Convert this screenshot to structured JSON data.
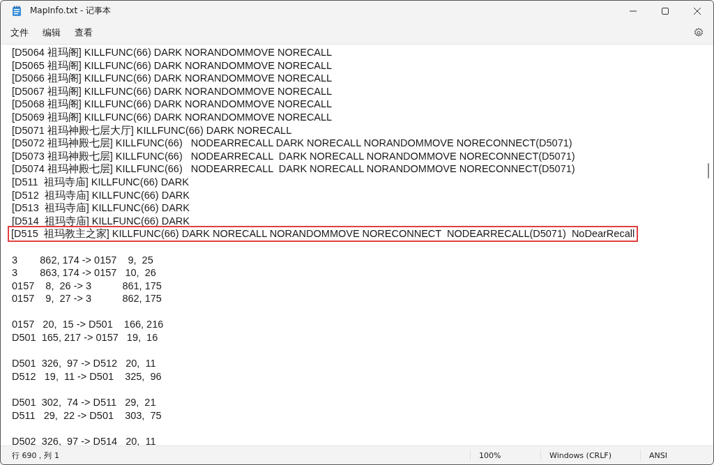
{
  "window": {
    "title": "MapInfo.txt - 记事本"
  },
  "menu": [
    "文件",
    "编辑",
    "查看"
  ],
  "blocks": [
    {
      "lines": [
        {
          "text": "[D5064 祖玛阁] KILLFUNC(66) DARK NORANDOMMOVE NORECALL",
          "highlighted": false
        },
        {
          "text": "[D5065 祖玛阁] KILLFUNC(66) DARK NORANDOMMOVE NORECALL",
          "highlighted": false
        },
        {
          "text": "[D5066 祖玛阁] KILLFUNC(66) DARK NORANDOMMOVE NORECALL",
          "highlighted": false
        },
        {
          "text": "[D5067 祖玛阁] KILLFUNC(66) DARK NORANDOMMOVE NORECALL",
          "highlighted": false
        },
        {
          "text": "[D5068 祖玛阁] KILLFUNC(66) DARK NORANDOMMOVE NORECALL",
          "highlighted": false
        },
        {
          "text": "[D5069 祖玛阁] KILLFUNC(66) DARK NORANDOMMOVE NORECALL",
          "highlighted": false
        },
        {
          "text": "[D5071 祖玛神殿七层大厅] KILLFUNC(66) DARK NORECALL",
          "highlighted": false
        },
        {
          "text": "[D5072 祖玛神殿七层] KILLFUNC(66)   NODEARRECALL DARK NORECALL NORANDOMMOVE NORECONNECT(D5071)",
          "highlighted": false
        },
        {
          "text": "[D5073 祖玛神殿七层] KILLFUNC(66)   NODEARRECALL  DARK NORECALL NORANDOMMOVE NORECONNECT(D5071)",
          "highlighted": false
        },
        {
          "text": "[D5074 祖玛神殿七层] KILLFUNC(66)   NODEARRECALL  DARK NORECALL NORANDOMMOVE NORECONNECT(D5071)",
          "highlighted": false
        },
        {
          "text": "[D511  祖玛寺庙] KILLFUNC(66) DARK",
          "highlighted": false
        },
        {
          "text": "[D512  祖玛寺庙] KILLFUNC(66) DARK",
          "highlighted": false
        },
        {
          "text": "[D513  祖玛寺庙] KILLFUNC(66) DARK",
          "highlighted": false
        },
        {
          "text": "[D514  祖玛寺庙] KILLFUNC(66) DARK",
          "highlighted": false
        },
        {
          "text": "[D515  祖玛教主之家] KILLFUNC(66) DARK NORECALL NORANDOMMOVE NORECONNECT  NODEARRECALL(D5071)  NoDearRecall",
          "highlighted": true
        }
      ]
    },
    {
      "lines": [
        {
          "text": "3        862, 174 -> 0157    9,  25",
          "highlighted": false
        },
        {
          "text": "3        863, 174 -> 0157   10,  26",
          "highlighted": false
        },
        {
          "text": "0157    8,  26 -> 3           861, 175",
          "highlighted": false
        },
        {
          "text": "0157    9,  27 -> 3           862, 175",
          "highlighted": false
        }
      ]
    },
    {
      "lines": [
        {
          "text": "0157   20,  15 -> D501    166, 216",
          "highlighted": false
        },
        {
          "text": "D501  165, 217 -> 0157   19,  16",
          "highlighted": false
        }
      ]
    },
    {
      "lines": [
        {
          "text": "D501  326,  97 -> D512   20,  11",
          "highlighted": false
        },
        {
          "text": "D512   19,  11 -> D501    325,  96",
          "highlighted": false
        }
      ]
    },
    {
      "lines": [
        {
          "text": "D501  302,  74 -> D511   29,  21",
          "highlighted": false
        },
        {
          "text": "D511   29,  22 -> D501    303,  75",
          "highlighted": false
        }
      ]
    },
    {
      "lines": [
        {
          "text": "D502  326,  97 -> D514   20,  11",
          "highlighted": false
        }
      ]
    }
  ],
  "status_bar": {
    "position": "行 690，列 1",
    "zoom": "100%",
    "line_ending": "Windows (CRLF)",
    "encoding": "ANSI"
  }
}
